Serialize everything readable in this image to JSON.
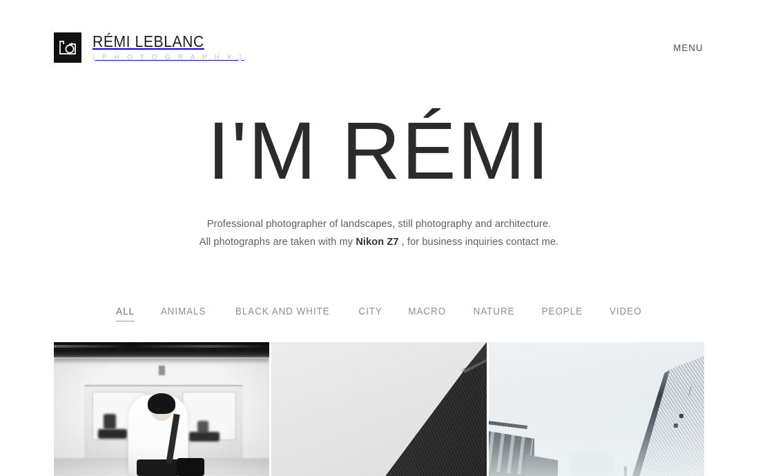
{
  "header": {
    "brand": {
      "logo_icon": "camera-icon",
      "name": "RÉMI LEBLANC",
      "tagline": "[  P H O T O G R A P H Y  ]"
    },
    "menu_label": "MENU"
  },
  "hero": {
    "title": "I'M RÉMI",
    "line1": "Professional photographer of landscapes, still photography and architecture.",
    "line2_before": "All photographs are taken with my ",
    "line2_highlight": "Nikon Z7",
    "line2_after": " , for business inquiries contact me."
  },
  "filters": {
    "active": "ALL",
    "items": [
      {
        "label": "ALL",
        "active": true
      },
      {
        "label": "ANIMALS",
        "active": false
      },
      {
        "label": "BLACK AND WHITE",
        "active": false
      },
      {
        "label": "CITY",
        "active": false
      },
      {
        "label": "MACRO",
        "active": false
      },
      {
        "label": "NATURE",
        "active": false
      },
      {
        "label": "PEOPLE",
        "active": false
      },
      {
        "label": "VIDEO",
        "active": false
      }
    ]
  },
  "gallery": {
    "items": [
      {
        "alt": "Black and white photograph of a woman with a ponytail waiting on a subway platform as a train passes in motion blur"
      },
      {
        "alt": "Minimalist architecture photograph of a dark angular building facade against a pale overcast sky"
      },
      {
        "alt": "Low angle city photograph of skyscrapers rising into pale blue-grey fog"
      }
    ]
  },
  "colors": {
    "background": "#ffffff",
    "heading": "#2b2b2b",
    "body_text": "#5b5f63",
    "muted": "#8f8f8f",
    "accent_underline": "#a89a7a",
    "logo_mark": "#111111"
  }
}
